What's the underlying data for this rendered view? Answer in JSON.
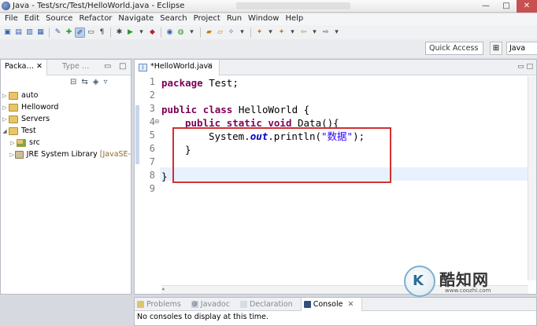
{
  "window": {
    "title": "Java - Test/src/Test/HelloWorld.java - Eclipse",
    "buttons": [
      "—",
      "□",
      "✕"
    ]
  },
  "menu": [
    "File",
    "Edit",
    "Source",
    "Refactor",
    "Navigate",
    "Search",
    "Project",
    "Run",
    "Window",
    "Help"
  ],
  "quick_access": {
    "placeholder": "Quick Access"
  },
  "perspective": {
    "label": "Java"
  },
  "package_explorer": {
    "tab_label": "Packa…",
    "tab2_label": "Type …",
    "items": [
      {
        "label": "auto",
        "depth": 0
      },
      {
        "label": "Helloword",
        "depth": 0
      },
      {
        "label": "Servers",
        "depth": 0
      },
      {
        "label": "Test",
        "depth": 0
      },
      {
        "label": "src",
        "depth": 1
      },
      {
        "label": "JRE System Library",
        "decoration": "[JavaSE-",
        "depth": 1
      }
    ]
  },
  "editor": {
    "tab_label": "*HelloWorld.java",
    "line_numbers": [
      "1",
      "2",
      "3",
      "4",
      "5",
      "6",
      "7",
      "8",
      "9"
    ],
    "code": {
      "l1_kw": "package",
      "l1_rest": " Test;",
      "l3_kw1": "public",
      "l3_kw2": "class",
      "l3_rest": " HelloWorld {",
      "l4_kw1": "public",
      "l4_kw2": "static",
      "l4_kw3": "void",
      "l4_rest": " Data(){",
      "l5_a": "System.",
      "l5_out": "out",
      "l5_b": ".println(",
      "l5_str": "\"数据\"",
      "l5_c": ");",
      "l6": "}",
      "l8": "}"
    }
  },
  "bottom_panel": {
    "tabs": [
      "Problems",
      "Javadoc",
      "Declaration",
      "Console"
    ],
    "message": "No consoles to display at this time."
  },
  "watermark": {
    "brand": "酷知网",
    "url": "www.coozhi.com",
    "logo_letter": "K"
  },
  "colors": {
    "keyword": "#7f0055",
    "string": "#2a00ff",
    "field": "#0000c0",
    "highlight": "#d32f2f"
  }
}
